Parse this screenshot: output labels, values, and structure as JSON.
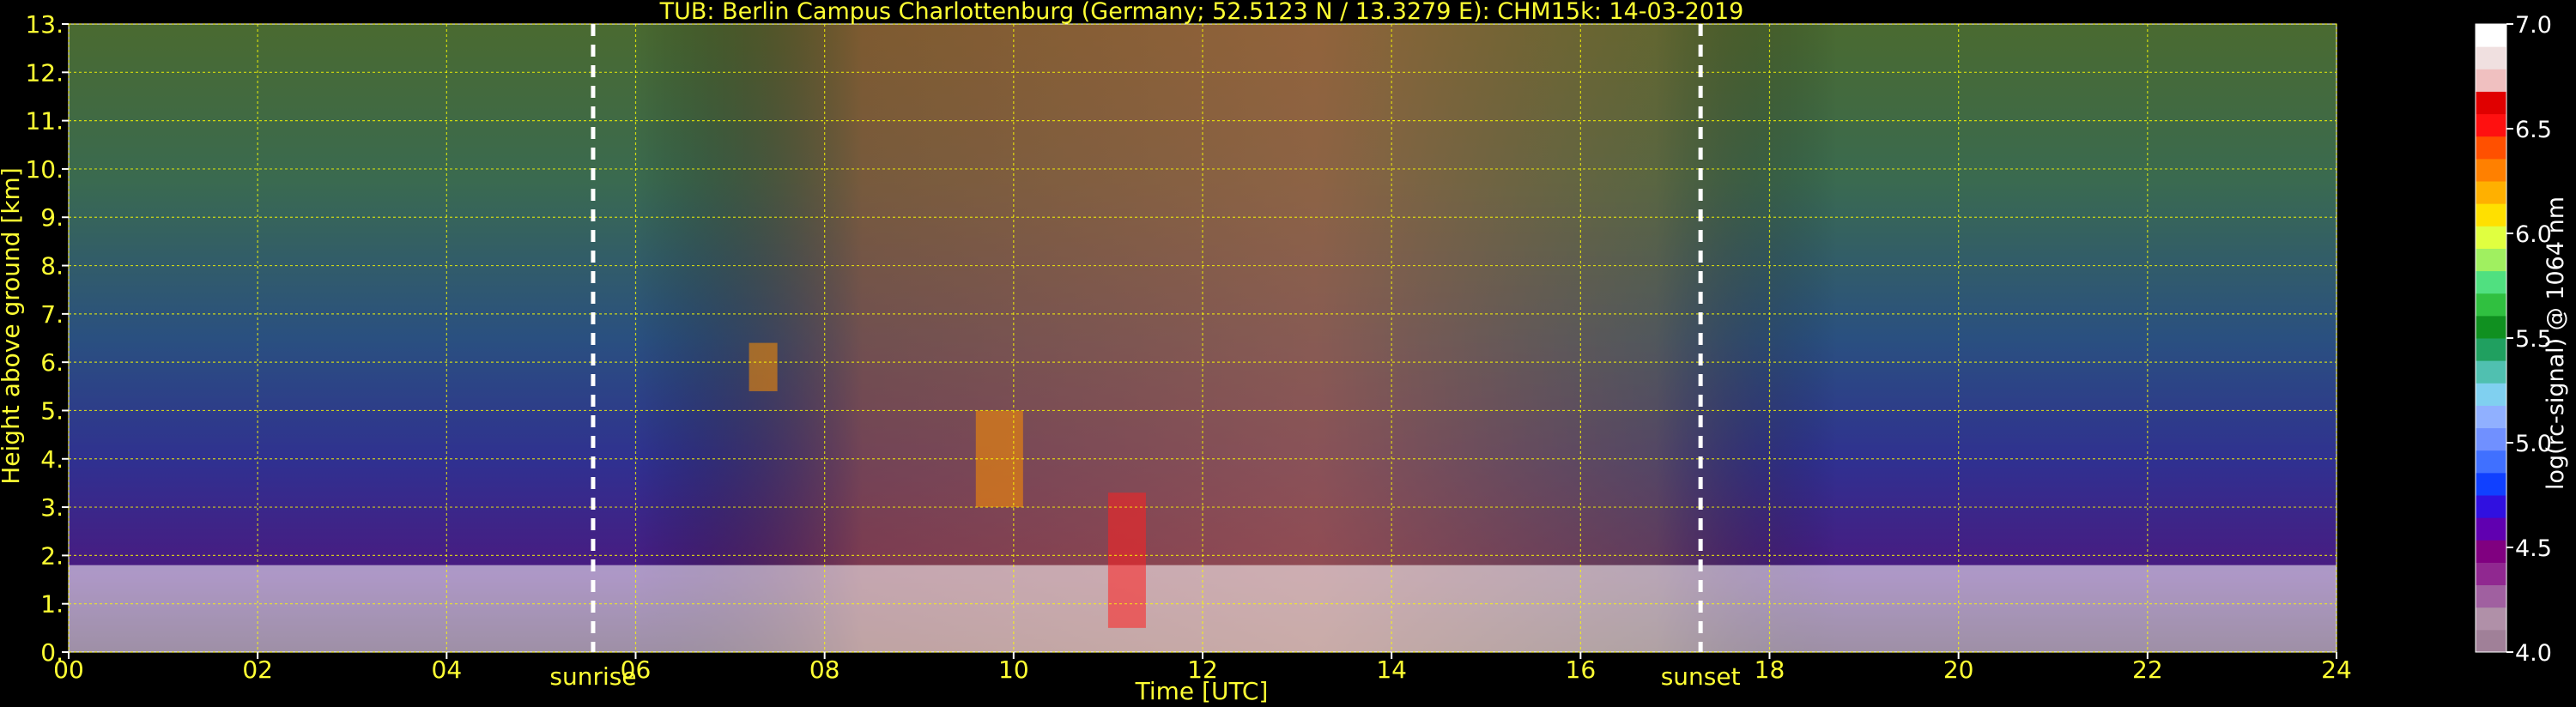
{
  "chart_data": {
    "type": "heatmap",
    "title": "TUB: Berlin Campus Charlottenburg (Germany; 52.5123 N / 13.3279 E):    CHM15k: 14-03-2019",
    "xlabel": "Time [UTC]",
    "ylabel": "Height above ground [km]",
    "xlim": [
      0,
      24
    ],
    "ylim": [
      0,
      13
    ],
    "x_ticks": [
      0,
      2,
      4,
      6,
      8,
      10,
      12,
      14,
      16,
      18,
      20,
      22,
      24
    ],
    "x_tick_labels": [
      "00",
      "02",
      "04",
      "06",
      "08",
      "10",
      "12",
      "14",
      "16",
      "18",
      "20",
      "22",
      "24"
    ],
    "y_ticks": [
      0,
      1,
      2,
      3,
      4,
      5,
      6,
      7,
      8,
      9,
      10,
      11,
      12,
      13
    ],
    "y_tick_labels": [
      "0.",
      "1.",
      "2.",
      "3.",
      "4.",
      "5.",
      "6.",
      "7.",
      "8.",
      "9.",
      "10.",
      "11.",
      "12.",
      "13."
    ],
    "grid": true,
    "grid_color": "#ffff00",
    "markers": [
      {
        "label": "sunrise",
        "x": 5.55
      },
      {
        "label": "sunset",
        "x": 17.27
      }
    ],
    "colorbar": {
      "label": "log(rc-signal) @ 1064 nm",
      "range": [
        4.0,
        7.0
      ],
      "ticks": [
        4.0,
        4.5,
        5.0,
        5.5,
        6.0,
        6.5,
        7.0
      ],
      "tick_labels": [
        "4.0",
        "4.5",
        "5.0",
        "5.5",
        "6.0",
        "6.5",
        "7.0"
      ],
      "colors": [
        "#a08098",
        "#b090a8",
        "#a060a0",
        "#902890",
        "#800080",
        "#6000b0",
        "#3010e0",
        "#1040ff",
        "#4070ff",
        "#7090ff",
        "#90b0ff",
        "#80d0f0",
        "#50c0b0",
        "#20a060",
        "#109020",
        "#30c040",
        "#50e080",
        "#a0f060",
        "#e0ff40",
        "#ffe000",
        "#ffb000",
        "#ff8000",
        "#ff5000",
        "#ff1010",
        "#e00000",
        "#f0c0c0",
        "#f0e0e0",
        "#ffffff"
      ]
    },
    "features": [
      {
        "name": "boundary layer signal",
        "x_range": [
          0,
          24
        ],
        "height_km": [
          0,
          1.8
        ]
      },
      {
        "name": "aerosol layer",
        "x_range": [
          7.2,
          7.5
        ],
        "height_km": [
          5.4,
          6.4
        ]
      },
      {
        "name": "aerosol layer",
        "x_range": [
          9.6,
          10.1
        ],
        "height_km": [
          3.0,
          5.0
        ]
      },
      {
        "name": "plume",
        "x_range": [
          11.0,
          11.4
        ],
        "height_km": [
          0.5,
          3.3
        ]
      }
    ]
  }
}
